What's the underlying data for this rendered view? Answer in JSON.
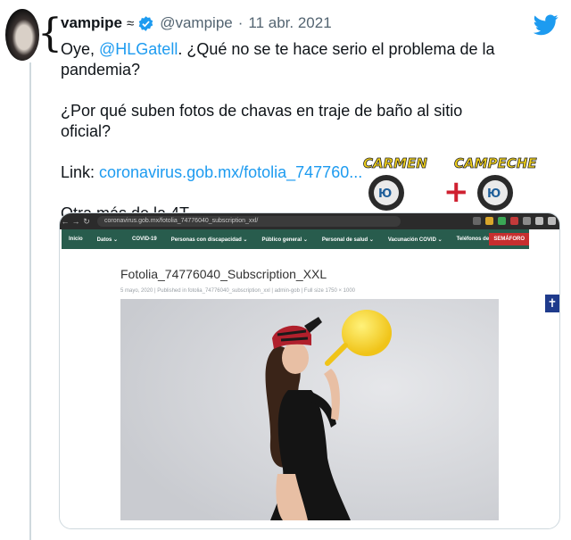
{
  "tweet": {
    "display_name": "vampipe",
    "name_emoji": "≈",
    "handle": "@vampipe",
    "separator": "·",
    "date": "11 abr. 2021",
    "line1_prefix": "Oye, ",
    "mention": "@HLGatell",
    "line1_suffix": ". ¿Qué no se te hace serio el problema de la pandemia?",
    "line2": "¿Por qué suben fotos de chavas en traje de baño al sitio oficial?",
    "link_prefix": "Link: ",
    "link": "coronavirus.gob.mx/fotolia_747760...",
    "line4": "Otra más de la 4T."
  },
  "sticker": {
    "left_text": "CARMEN",
    "right_text": "CAMPECHE",
    "plus": "+"
  },
  "screenshot": {
    "url": "coronavirus.gob.mx/fotolia_74776040_subscription_xxl/",
    "nav_items": [
      "Inicio",
      "Datos ⌄",
      "COVID-19",
      "Personas con discapacidad ⌄",
      "Público general ⌄",
      "Personal de salud ⌄",
      "Vacunación COVID ⌄",
      "Teléfonos de contacto"
    ],
    "semaforo": "SEMÁFORO",
    "title": "Fotolia_74776040_Subscription_XXL",
    "meta": "5 mayo, 2020   |  Published in fotolia_74776040_subscription_xxl   |  admin-gob   |  Full size 1750 × 1000"
  },
  "colors": {
    "link": "#1d9bf0",
    "verified": "#1d9bf0",
    "gov_green": "#285c4d",
    "semaforo_red": "#c62f2f"
  }
}
